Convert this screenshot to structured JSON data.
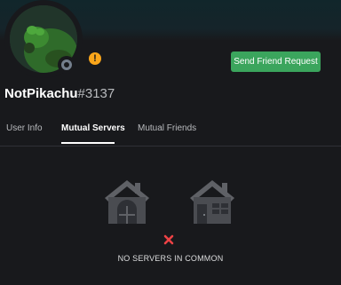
{
  "profile": {
    "username": "NotPikachu",
    "discriminator": "#3137",
    "status_icon": "offline-status-icon",
    "badge_symbol": "!",
    "badge_color": "#faa61a"
  },
  "actions": {
    "send_friend_request": "Send Friend Request",
    "button_color": "#3ba55d"
  },
  "tabs": [
    {
      "label": "User Info",
      "active": false
    },
    {
      "label": "Mutual Servers",
      "active": true
    },
    {
      "label": "Mutual Friends",
      "active": false
    }
  ],
  "empty_state": {
    "message": "NO SERVERS IN COMMON",
    "icons": [
      "server-house-icon",
      "server-house-icon",
      "close-icon"
    ],
    "cross_color": "#ed4245"
  }
}
